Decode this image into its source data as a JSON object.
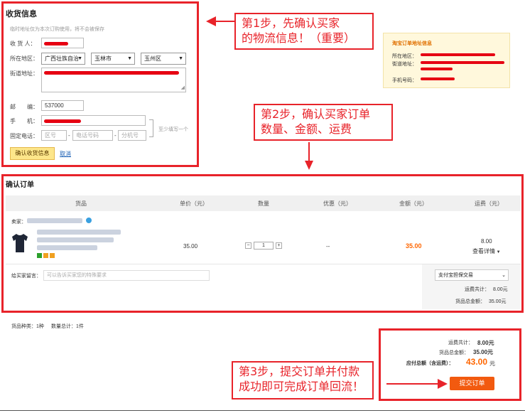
{
  "receiver": {
    "title": "收货信息",
    "hint": "临时地址仅为本次订购使用，将不会被保存",
    "name_label": "收 货 人：",
    "region_label": "所在地区：",
    "province": "广西壮族自治",
    "city": "玉林市",
    "district": "玉州区",
    "street_label": "街道地址：",
    "zip_label": "邮　　编：",
    "zip_value": "537000",
    "mobile_label": "手　　机：",
    "phone_label": "固定电话：",
    "area_code_placeholder": "区号",
    "phone_placeholder": "电话号码",
    "ext_placeholder": "分机号",
    "phone_sep": "-",
    "either_hint": "至少填写一个",
    "confirm_button": "确认收货信息",
    "cancel_link": "取消"
  },
  "taobao_info": {
    "title": "淘宝订单地址信息",
    "region_label": "所在地区：",
    "street_label": "街道地址：",
    "mobile_label": "手机号码："
  },
  "callouts": {
    "step1_line1": "第1步，先确认买家",
    "step1_line2": "的物流信息！（重要）",
    "step2_line1": "第2步，确认买家订单",
    "step2_line2": "数量、金额、运费",
    "step3_line1": "第3步，提交订单并付款",
    "step3_line2": "成功即可完成订单回流！"
  },
  "order": {
    "title": "确认订单",
    "columns": [
      "货品",
      "单价（元）",
      "数量",
      "优惠（元）",
      "金额（元）",
      "运费（元）"
    ],
    "seller_label": "卖家：",
    "unit_price": "35.00",
    "quantity": "1",
    "discount": "--",
    "amount": "35.00",
    "shipping_fee": "8.00",
    "shipping_detail": "查看详情",
    "qty_minus": "−",
    "qty_plus": "+",
    "message_label": "给买家留言：",
    "message_placeholder": "可以告诉买家您的特殊要求",
    "payment_method": "支付宝担保交易",
    "shipping_total_label": "运费共计：",
    "shipping_total": "8.00元",
    "goods_total_label": "货品总金额：",
    "goods_total": "35.00元",
    "product_kinds": "货品种类：1种",
    "quantity_total": "数量总计：1件"
  },
  "summary": {
    "shipping_label": "运费共计：",
    "shipping_value": "8.00元",
    "goods_label": "货品总金额：",
    "goods_value": "35.00元",
    "payable_label": "应付总额（含运费）：",
    "payable_value": "43.00",
    "payable_unit": "元",
    "submit_button": "提交订单"
  },
  "colors": {
    "highlight_red": "#e8232a",
    "price_orange": "#ff6600",
    "submit_orange": "#f25a0f"
  }
}
